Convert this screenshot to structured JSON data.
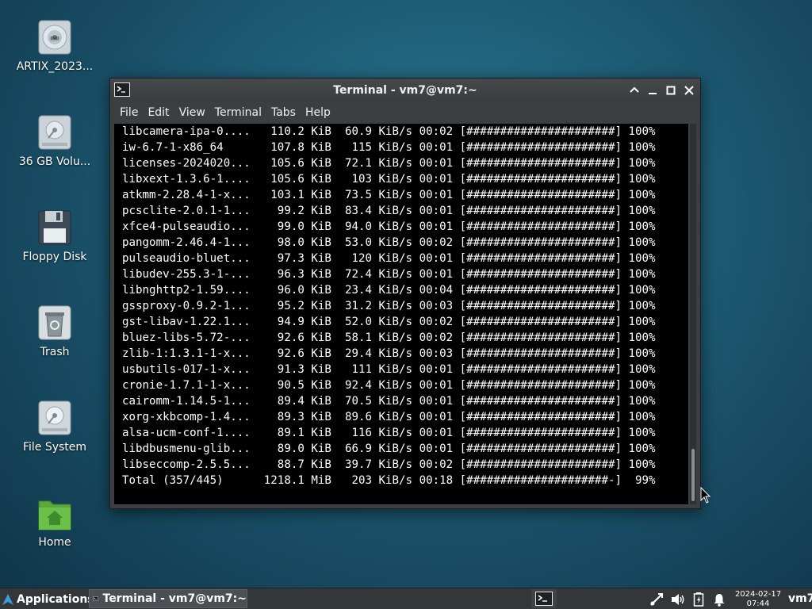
{
  "desktop": {
    "icons": [
      {
        "label": "ARTIX_2023...",
        "icon": "optical-disc-icon"
      },
      {
        "label": "36 GB Volu...",
        "icon": "hard-drive-icon"
      },
      {
        "label": "Floppy Disk",
        "icon": "floppy-disk-icon"
      },
      {
        "label": "Trash",
        "icon": "trash-icon"
      },
      {
        "label": "File System",
        "icon": "file-system-drive-icon"
      },
      {
        "label": "Home",
        "icon": "home-folder-icon"
      }
    ]
  },
  "window": {
    "title": "Terminal - vm7@vm7:~",
    "menu": [
      "File",
      "Edit",
      "View",
      "Terminal",
      "Tabs",
      "Help"
    ],
    "controls": [
      "roll-up",
      "minimize",
      "maximize",
      "close"
    ]
  },
  "terminal": {
    "lines": [
      "libcamera-ipa-0....   110.2 KiB  60.9 KiB/s 00:02 [######################] 100%",
      "iw-6.7-1-x86_64       107.8 KiB   115 KiB/s 00:01 [######################] 100%",
      "licenses-2024020...   105.6 KiB  72.1 KiB/s 00:01 [######################] 100%",
      "libxext-1.3.6-1....   105.6 KiB   103 KiB/s 00:01 [######################] 100%",
      "atkmm-2.28.4-1-x...   103.1 KiB  73.5 KiB/s 00:01 [######################] 100%",
      "pcsclite-2.0.1-1...    99.2 KiB  83.4 KiB/s 00:01 [######################] 100%",
      "xfce4-pulseaudio...    99.0 KiB  94.0 KiB/s 00:01 [######################] 100%",
      "pangomm-2.46.4-1...    98.0 KiB  53.0 KiB/s 00:02 [######################] 100%",
      "pulseaudio-bluet...    97.3 KiB   120 KiB/s 00:01 [######################] 100%",
      "libudev-255.3-1-...    96.3 KiB  72.4 KiB/s 00:01 [######################] 100%",
      "libnghttp2-1.59....    96.0 KiB  23.4 KiB/s 00:04 [######################] 100%",
      "gssproxy-0.9.2-1...    95.2 KiB  31.2 KiB/s 00:03 [######################] 100%",
      "gst-libav-1.22.1...    94.9 KiB  52.0 KiB/s 00:02 [######################] 100%",
      "bluez-libs-5.72-...    92.6 KiB  58.1 KiB/s 00:02 [######################] 100%",
      "zlib-1:1.3.1-1-x...    92.6 KiB  29.4 KiB/s 00:03 [######################] 100%",
      "usbutils-017-1-x...    91.3 KiB   111 KiB/s 00:01 [######################] 100%",
      "cronie-1.7.1-1-x...    90.5 KiB  92.4 KiB/s 00:01 [######################] 100%",
      "cairomm-1.14.5-1...    89.4 KiB  70.5 KiB/s 00:01 [######################] 100%",
      "xorg-xkbcomp-1.4...    89.3 KiB  89.6 KiB/s 00:01 [######################] 100%",
      "alsa-ucm-conf-1....    89.1 KiB   116 KiB/s 00:01 [######################] 100%",
      "libdbusmenu-glib...    89.0 KiB  66.9 KiB/s 00:01 [######################] 100%",
      "libseccomp-2.5.5...    88.7 KiB  39.7 KiB/s 00:02 [######################] 100%",
      "Total (357/445)      1218.1 MiB   203 KiB/s 00:18 [#####################-]  99%"
    ]
  },
  "taskbar": {
    "applications_label": "Applications",
    "task_label": "Terminal - vm7@vm7:~",
    "clock_date": "2024-02-17",
    "clock_time": "07:44",
    "user": "vm7",
    "tray_icons": [
      "network-icon",
      "volume-icon",
      "battery-icon",
      "notification-bell-icon"
    ]
  },
  "colors": {
    "terminal_bg": "#000000",
    "terminal_fg": "#ffffff",
    "window_chrome": "#3b3f42",
    "taskbar_bg": "#33373a",
    "desktop_accent": "#1f5f78"
  }
}
